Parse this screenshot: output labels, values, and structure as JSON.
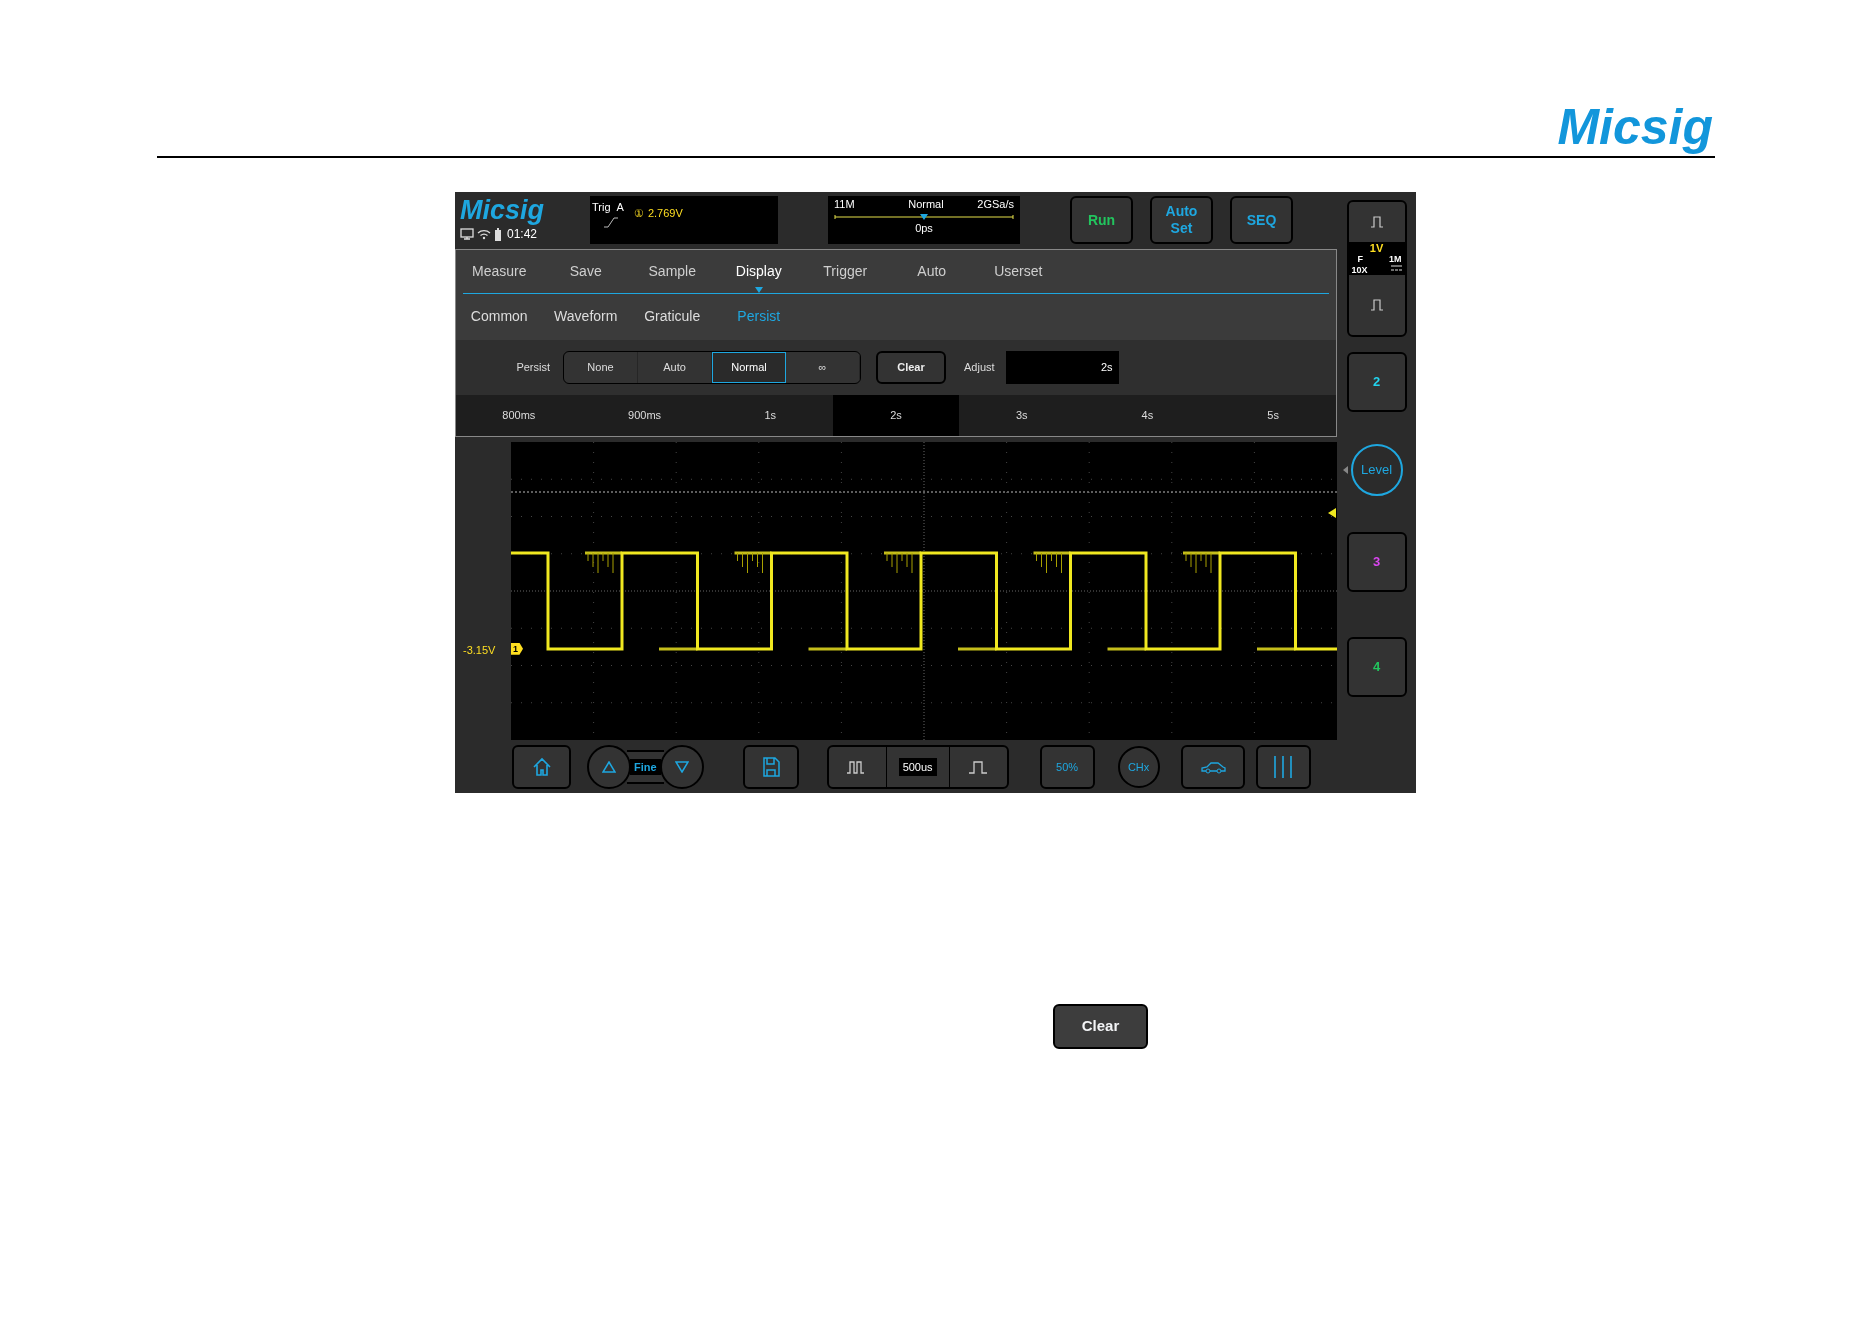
{
  "page_header": {
    "logo": "Micsig"
  },
  "scope": {
    "status": {
      "logo": "Micsig",
      "time": "01:42"
    },
    "trigger": {
      "label": "Trig",
      "source": "A",
      "channel": "①",
      "level": "2.769V"
    },
    "timebase": {
      "memory": "11M",
      "mode": "Normal",
      "rate": "2GSa/s",
      "offset": "0ps"
    },
    "buttons": [
      {
        "label": "Run",
        "color": "#22c55e"
      },
      {
        "label": "Auto Set",
        "color": "#1ea7e0"
      },
      {
        "label": "SEQ",
        "color": "#1ea7e0"
      }
    ],
    "menu_tabs": [
      {
        "label": "Measure",
        "selected": false
      },
      {
        "label": "Save",
        "selected": false
      },
      {
        "label": "Sample",
        "selected": false
      },
      {
        "label": "Display",
        "selected": true
      },
      {
        "label": "Trigger",
        "selected": false
      },
      {
        "label": "Auto",
        "selected": false
      },
      {
        "label": "Userset",
        "selected": false
      }
    ],
    "sub_tabs": [
      {
        "label": "Common",
        "selected": false
      },
      {
        "label": "Waveform",
        "selected": false
      },
      {
        "label": "Graticule",
        "selected": false
      },
      {
        "label": "Persist",
        "selected": true
      }
    ],
    "persist": {
      "label": "Persist",
      "options": [
        {
          "label": "None",
          "selected": false
        },
        {
          "label": "Auto",
          "selected": false
        },
        {
          "label": "Normal",
          "selected": true
        },
        {
          "label": "∞",
          "selected": false
        }
      ],
      "clear": "Clear",
      "adjust_label": "Adjust",
      "adjust_value": "2s"
    },
    "durations": [
      {
        "label": "800ms",
        "selected": false
      },
      {
        "label": "900ms",
        "selected": false
      },
      {
        "label": "1s",
        "selected": false
      },
      {
        "label": "2s",
        "selected": true
      },
      {
        "label": "3s",
        "selected": false
      },
      {
        "label": "4s",
        "selected": false
      },
      {
        "label": "5s",
        "selected": false
      }
    ],
    "waveform": {
      "offset_label": "-3.15V",
      "channel_marker": "1"
    },
    "toolbar": {
      "fine": "Fine",
      "timebase": "500us",
      "percent": "50%",
      "channel": "CHx"
    },
    "channel_1": {
      "scale": "1V",
      "coupling": "F",
      "probe": "10X",
      "impedance": "1M"
    },
    "side": [
      {
        "kind": "channel",
        "label": "2",
        "color": "#22d3ee"
      },
      {
        "kind": "level",
        "label": "Level"
      },
      {
        "kind": "channel",
        "label": "3",
        "color": "#d946ef"
      },
      {
        "kind": "channel",
        "label": "4",
        "color": "#22c55e"
      }
    ]
  },
  "footer_button": {
    "label": "Clear"
  }
}
